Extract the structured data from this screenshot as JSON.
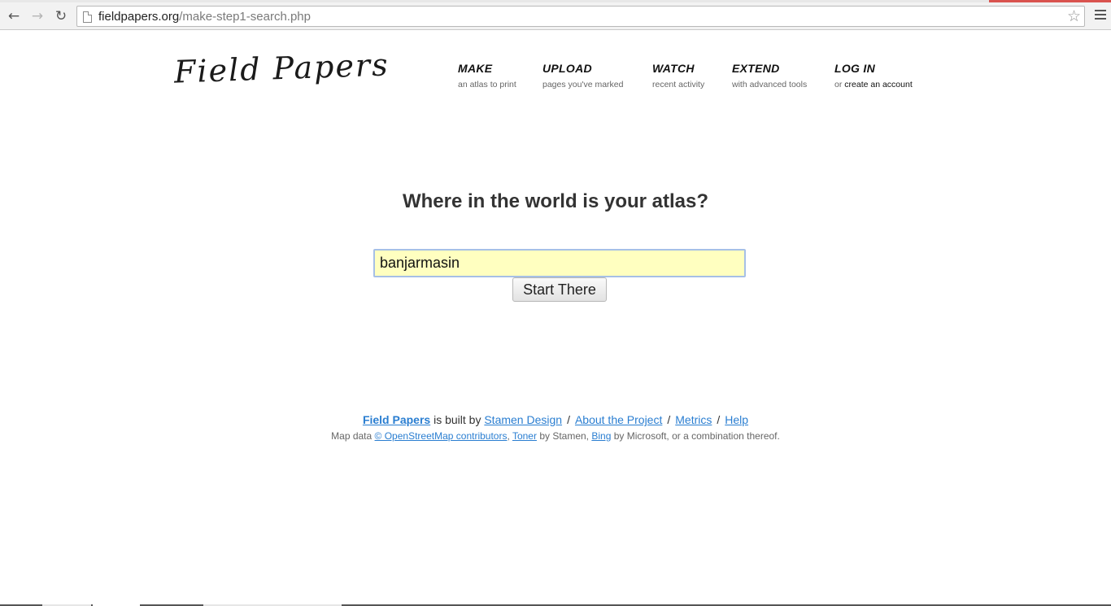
{
  "browser": {
    "url_host": "fieldpapers.org",
    "url_path": "/make-step1-search.php",
    "icons": {
      "back": "back-arrow-icon",
      "forward": "forward-arrow-icon",
      "reload": "reload-icon",
      "page": "page-icon",
      "bookmark": "star-icon",
      "menu": "hamburger-menu-icon"
    }
  },
  "header": {
    "logo": "Field Papers",
    "nav": [
      {
        "label": "MAKE",
        "sub": "an atlas to print"
      },
      {
        "label": "UPLOAD",
        "sub": "pages you've marked"
      },
      {
        "label": "WATCH",
        "sub": "recent activity"
      },
      {
        "label": "EXTEND",
        "sub": "with advanced tools"
      },
      {
        "label": "LOG IN",
        "sub_prefix": "or ",
        "sub_link": "create an account"
      }
    ]
  },
  "main": {
    "headline": "Where in the world is your atlas?",
    "search_value": "banjarmasin",
    "button_label": "Start There"
  },
  "footer": {
    "brand": "Field Papers",
    "built_by_text": "is built by",
    "stamen": "Stamen Design",
    "about": "About the Project",
    "metrics": "Metrics",
    "help": "Help",
    "separator": "/",
    "map_data_prefix": "Map data",
    "osm": "© OpenStreetMap contributors",
    "comma": ",",
    "toner": "Toner",
    "by_stamen": "by Stamen,",
    "bing": "Bing",
    "by_microsoft": "by Microsoft, or a combination thereof."
  },
  "colors": {
    "link": "#2a7ed1",
    "input_bg": "#ffffc0",
    "input_border": "#a6c0e6"
  }
}
